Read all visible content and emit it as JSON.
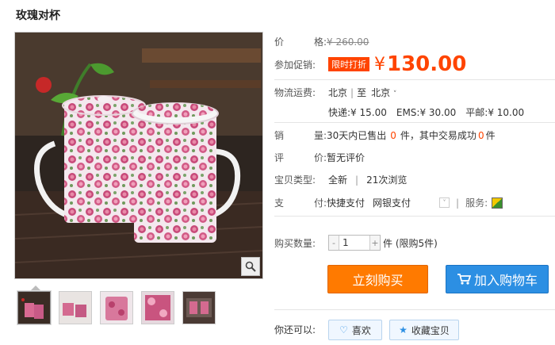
{
  "product": {
    "title": "玫瑰对杯"
  },
  "price": {
    "label_chars": [
      "价",
      "格:"
    ],
    "original": "¥ 260.00"
  },
  "promo": {
    "label": "参加促销:",
    "badge": "限时打折",
    "yen": "¥",
    "price": "130.00"
  },
  "shipping": {
    "label": "物流运费:",
    "from": "北京",
    "to_prefix": "至",
    "to": "北京",
    "express_label": "快递:",
    "express_price": "¥ 15.00",
    "ems_label": "EMS:",
    "ems_price": "¥ 30.00",
    "mail_label": "平邮:",
    "mail_price": "¥ 10.00"
  },
  "sales": {
    "label_chars": [
      "销",
      "量:"
    ],
    "text_a": "30天内已售出",
    "sold": "0",
    "text_b": "件，其中交易成功",
    "success": "0",
    "text_c": "件"
  },
  "review": {
    "label_chars": [
      "评",
      "价:"
    ],
    "text": "暂无评价"
  },
  "type": {
    "label": "宝贝类型:",
    "condition": "全新",
    "views": "21次浏览"
  },
  "payment": {
    "label_chars": [
      "支",
      "付:"
    ],
    "quick": "快捷支付",
    "bank": "网银支付",
    "service_label": "服务:"
  },
  "quantity": {
    "label": "购买数量:",
    "minus": "-",
    "value": "1",
    "plus": "+",
    "limit": "件 (限购5件)"
  },
  "actions": {
    "buy_now": "立刻购买",
    "add_cart": "加入购物车",
    "also_label": "你还可以:",
    "like": "喜欢",
    "favorite": "收藏宝贝"
  },
  "colors": {
    "accent": "#ff4400",
    "buy_button": "#ff7a00",
    "cart_button": "#2c8fe3"
  }
}
